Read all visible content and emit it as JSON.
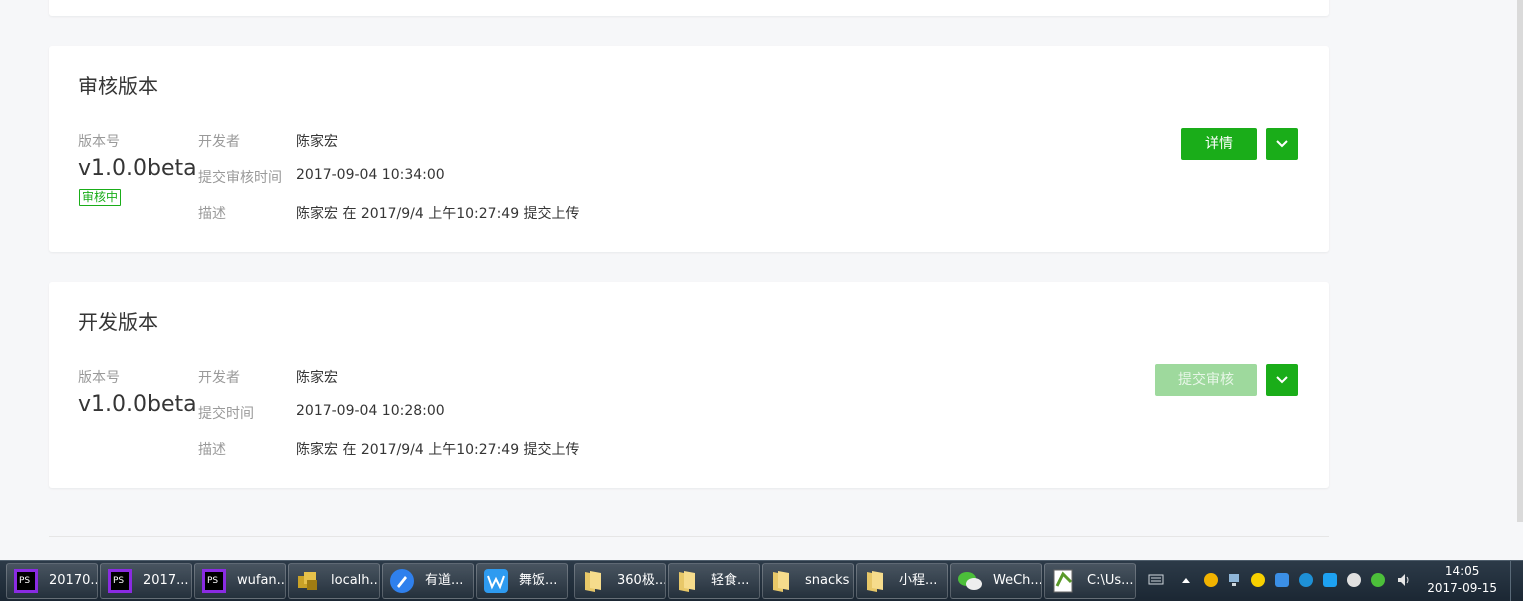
{
  "review": {
    "title": "审核版本",
    "version_label": "版本号",
    "version": "v1.0.0beta",
    "status_badge": "审核中",
    "developer_label": "开发者",
    "developer": "陈家宏",
    "time_label": "提交审核时间",
    "time": "2017-09-04 10:34:00",
    "desc_label": "描述",
    "desc": "陈家宏 在 2017/9/4 上午10:27:49 提交上传",
    "primary_button": "详情"
  },
  "dev": {
    "title": "开发版本",
    "version_label": "版本号",
    "version": "v1.0.0beta",
    "developer_label": "开发者",
    "developer": "陈家宏",
    "time_label": "提交时间",
    "time": "2017-09-04 10:28:00",
    "desc_label": "描述",
    "desc": "陈家宏 在 2017/9/4 上午10:27:49 提交上传",
    "primary_button": "提交审核"
  },
  "colors": {
    "accent": "#1aad19",
    "accent_disabled": "#9ed99d",
    "background": "#f6f7f9"
  },
  "taskbar": {
    "tasks": [
      {
        "label": "20170...",
        "icon": "phpstorm-icon"
      },
      {
        "label": "2017...",
        "icon": "phpstorm-icon"
      },
      {
        "label": "wufan...",
        "icon": "phpstorm-icon"
      },
      {
        "label": "localh...",
        "icon": "navicat-icon"
      },
      {
        "label": "有道...",
        "icon": "youdao-note-icon"
      },
      {
        "label": "舞饭...",
        "icon": "wps-icon"
      },
      {
        "label": "360极...",
        "icon": "folder-icon"
      },
      {
        "label": "轻食...",
        "icon": "folder-icon"
      },
      {
        "label": "snacks",
        "icon": "folder-icon"
      },
      {
        "label": "小程...",
        "icon": "folder-icon"
      },
      {
        "label": "WeCh...",
        "icon": "wechat-icon"
      },
      {
        "label": "C:\\Us...",
        "icon": "notepad-plus-icon"
      }
    ],
    "time": "14:05",
    "date": "2017-09-15"
  }
}
